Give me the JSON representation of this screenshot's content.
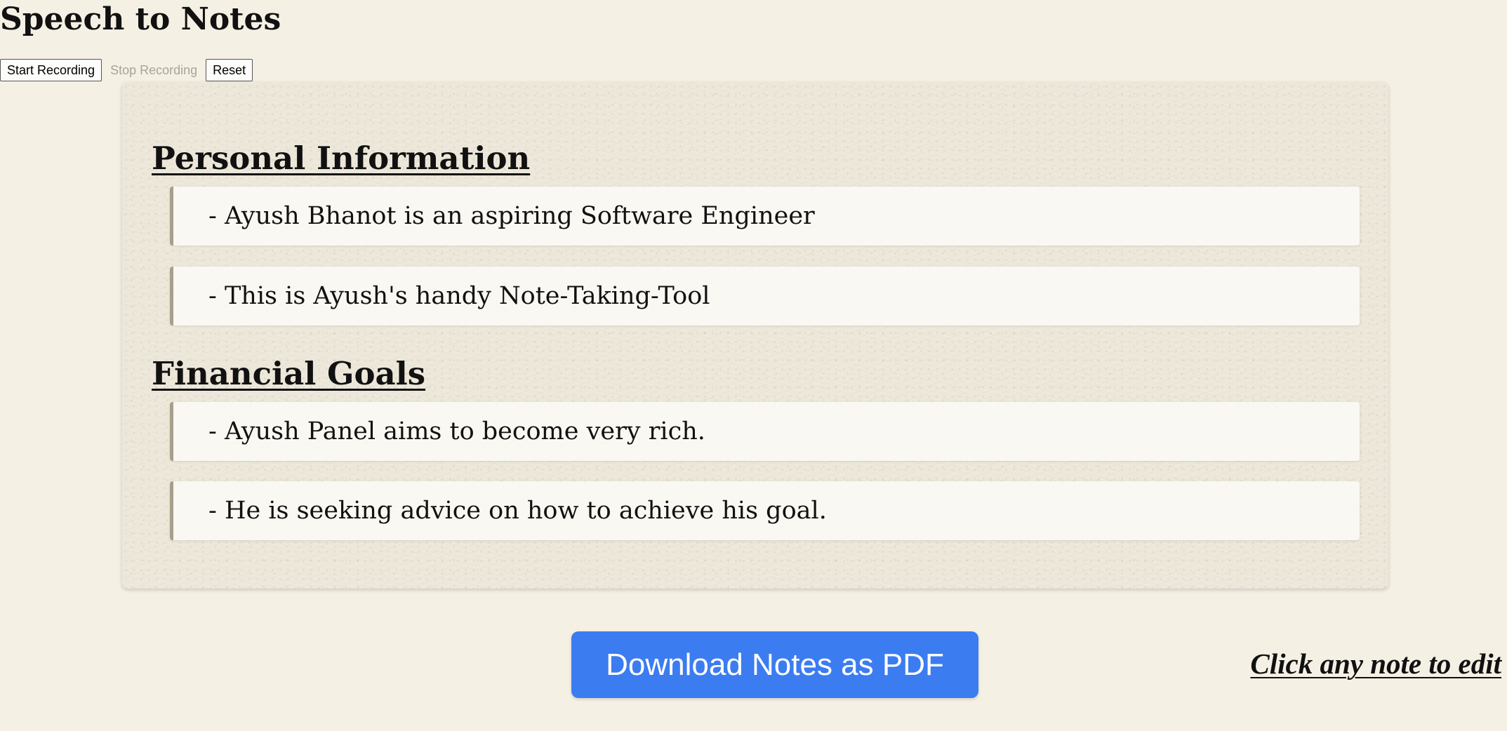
{
  "app": {
    "title": "Speech to Notes"
  },
  "controls": {
    "start_label": "Start Recording",
    "stop_label": "Stop Recording",
    "reset_label": "Reset"
  },
  "notes": {
    "sections": [
      {
        "heading": "Personal Information",
        "items": [
          "- Ayush Bhanot is an aspiring Software Engineer",
          "- This is Ayush's handy Note-Taking-Tool"
        ]
      },
      {
        "heading": "Financial Goals",
        "items": [
          "- Ayush Panel aims to become very rich.",
          "- He is seeking advice on how to achieve his goal."
        ]
      }
    ]
  },
  "footer": {
    "download_label": "Download Notes as PDF",
    "edit_hint": "Click any note to edit"
  },
  "colors": {
    "background": "#f5f0e4",
    "paper": "#ece7d9",
    "accent_button": "#3b7cf1",
    "note_border": "#a89e8c",
    "disabled_text": "#a9a49b"
  }
}
